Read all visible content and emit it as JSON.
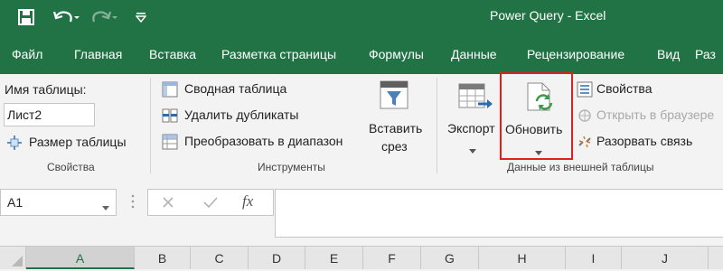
{
  "window": {
    "title": "Power Query  -  Excel"
  },
  "tabs": [
    "Файл",
    "Главная",
    "Вставка",
    "Разметка страницы",
    "Формулы",
    "Данные",
    "Рецензирование",
    "Вид",
    "Раз"
  ],
  "ribbon": {
    "properties_group": {
      "table_name_label": "Имя таблицы:",
      "table_name_value": "Лист2",
      "resize_label": "Размер таблицы",
      "group_label": "Свойства"
    },
    "tools_group": {
      "pivot_label": "Сводная таблица",
      "remove_dupes_label": "Удалить дубликаты",
      "convert_label": "Преобразовать в диапазон",
      "slicer_line1": "Вставить",
      "slicer_line2": "срез",
      "group_label": "Инструменты"
    },
    "external_group": {
      "export_label": "Экспорт",
      "refresh_label": "Обновить",
      "properties_label": "Свойства",
      "open_browser_label": "Открыть в браузере",
      "unlink_label": "Разорвать связь",
      "group_label": "Данные из внешней таблицы"
    },
    "highlight_color": "#e0201f"
  },
  "formula_bar": {
    "name_box": "A1",
    "fx": "fx",
    "value": ""
  },
  "columns": [
    "A",
    "B",
    "C",
    "D",
    "E",
    "F",
    "G",
    "H",
    "I",
    "J"
  ],
  "selected_column": "A",
  "colors": {
    "brand": "#217346"
  }
}
